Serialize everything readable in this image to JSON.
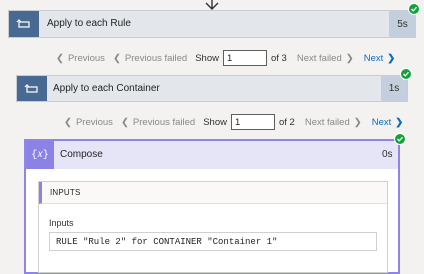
{
  "outer_loop": {
    "title": "Apply to each Rule",
    "duration": "5s",
    "status_icon": "check-icon",
    "pager": {
      "previous": "Previous",
      "previous_failed": "Previous failed",
      "show_label": "Show",
      "current_value": "1",
      "of_total": "of 3",
      "next_failed": "Next failed",
      "next": "Next"
    }
  },
  "inner_loop": {
    "title": "Apply to each Container",
    "duration": "1s",
    "status_icon": "check-icon",
    "pager": {
      "previous": "Previous",
      "previous_failed": "Previous failed",
      "show_label": "Show",
      "current_value": "1",
      "of_total": "of 2",
      "next_failed": "Next failed",
      "next": "Next"
    }
  },
  "compose": {
    "title": "Compose",
    "duration": "0s",
    "icon_glyph": "{𝑥}",
    "inputs_header": "INPUTS",
    "inputs_label": "Inputs",
    "inputs_value": "RULE \"Rule 2\" for CONTAINER \"Container 1\""
  },
  "colors": {
    "loop_icon_bg": "#486991",
    "compose_accent": "#8c82e6",
    "success_green": "#14a03c",
    "link_blue": "#0f6cbd"
  }
}
